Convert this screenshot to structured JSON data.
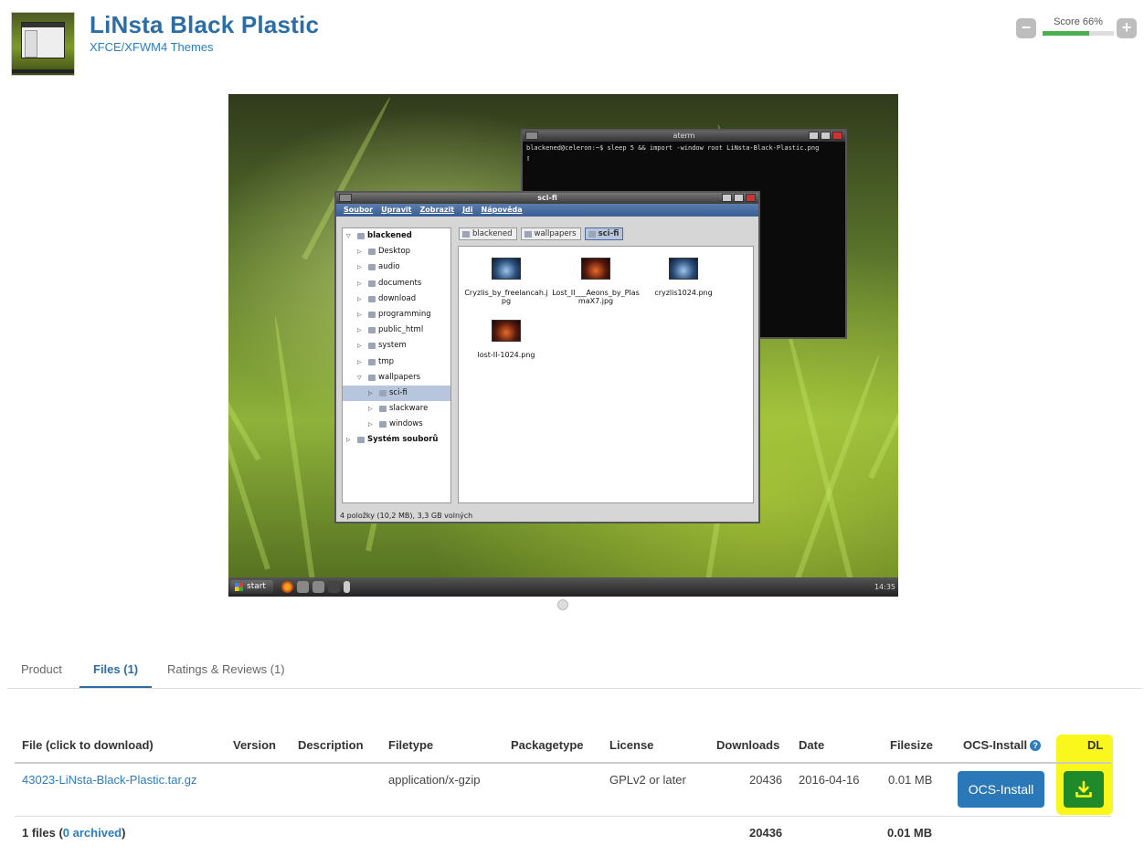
{
  "header": {
    "title": "LiNsta Black Plastic",
    "category": "XFCE/XFWM4 Themes",
    "score_label": "Score 66%",
    "score_value": 66,
    "minus_label": "−",
    "plus_label": "+"
  },
  "screenshot": {
    "terminal_title": "aterm",
    "terminal_line1": "blackened@celeron:~$ sleep 5 && import -window root LiNsta-Black-Plastic.png",
    "terminal_cursor": "▯",
    "window_title": "sci-fi",
    "menu": [
      "Soubor",
      "Upravit",
      "Zobrazit",
      "Jdi",
      "Nápověda"
    ],
    "tree": [
      {
        "label": "blackened",
        "level": 0,
        "bold": true,
        "open": true
      },
      {
        "label": "Desktop",
        "level": 1
      },
      {
        "label": "audio",
        "level": 1
      },
      {
        "label": "documents",
        "level": 1
      },
      {
        "label": "download",
        "level": 1
      },
      {
        "label": "programming",
        "level": 1
      },
      {
        "label": "public_html",
        "level": 1
      },
      {
        "label": "system",
        "level": 1
      },
      {
        "label": "tmp",
        "level": 1
      },
      {
        "label": "wallpapers",
        "level": 1,
        "open": true
      },
      {
        "label": "sci-fi",
        "level": 2,
        "selected": true
      },
      {
        "label": "slackware",
        "level": 2
      },
      {
        "label": "windows",
        "level": 2
      },
      {
        "label": "Systém souborů",
        "level": 0,
        "bold": true
      }
    ],
    "path": [
      "blackened",
      "wallpapers",
      "sci-fi"
    ],
    "files": [
      {
        "name": "Cryzlis_by_freelancah.jpg",
        "color": "blue"
      },
      {
        "name": "Lost_II___Aeons_by_PlasmaX7.jpg",
        "color": "red"
      },
      {
        "name": "cryzlis1024.png",
        "color": "blue"
      },
      {
        "name": "lost-II-1024.png",
        "color": "red"
      }
    ],
    "status": "4 položky (10,2 MB), 3,3 GB volných",
    "start_label": "start",
    "clock": "14:35"
  },
  "tabs": [
    {
      "label": "Product",
      "active": false
    },
    {
      "label": "Files (1)",
      "active": true
    },
    {
      "label": "Ratings & Reviews (1)",
      "active": false
    }
  ],
  "table": {
    "headers": {
      "file": "File (click to download)",
      "version": "Version",
      "description": "Description",
      "filetype": "Filetype",
      "packagetype": "Packagetype",
      "license": "License",
      "downloads": "Downloads",
      "date": "Date",
      "filesize": "Filesize",
      "ocs": "OCS-Install",
      "dl": "DL"
    },
    "row": {
      "file": "43023-LiNsta-Black-Plastic.tar.gz",
      "filetype": "application/x-gzip",
      "license": "GPLv2 or later",
      "downloads": "20436",
      "date": "2016-04-16",
      "filesize": "0.01 MB",
      "ocs_button": "OCS-Install"
    },
    "footer": {
      "files_prefix": "1 files (",
      "archived_link": "0 archived",
      "files_suffix": ")",
      "downloads_total": "20436",
      "filesize_total": "0.01 MB"
    }
  },
  "colors": {
    "accent": "#2c6ea3",
    "ocs_button": "#2a78b7",
    "dl_button": "#1e8a2a",
    "highlight": "#f9f71b"
  }
}
